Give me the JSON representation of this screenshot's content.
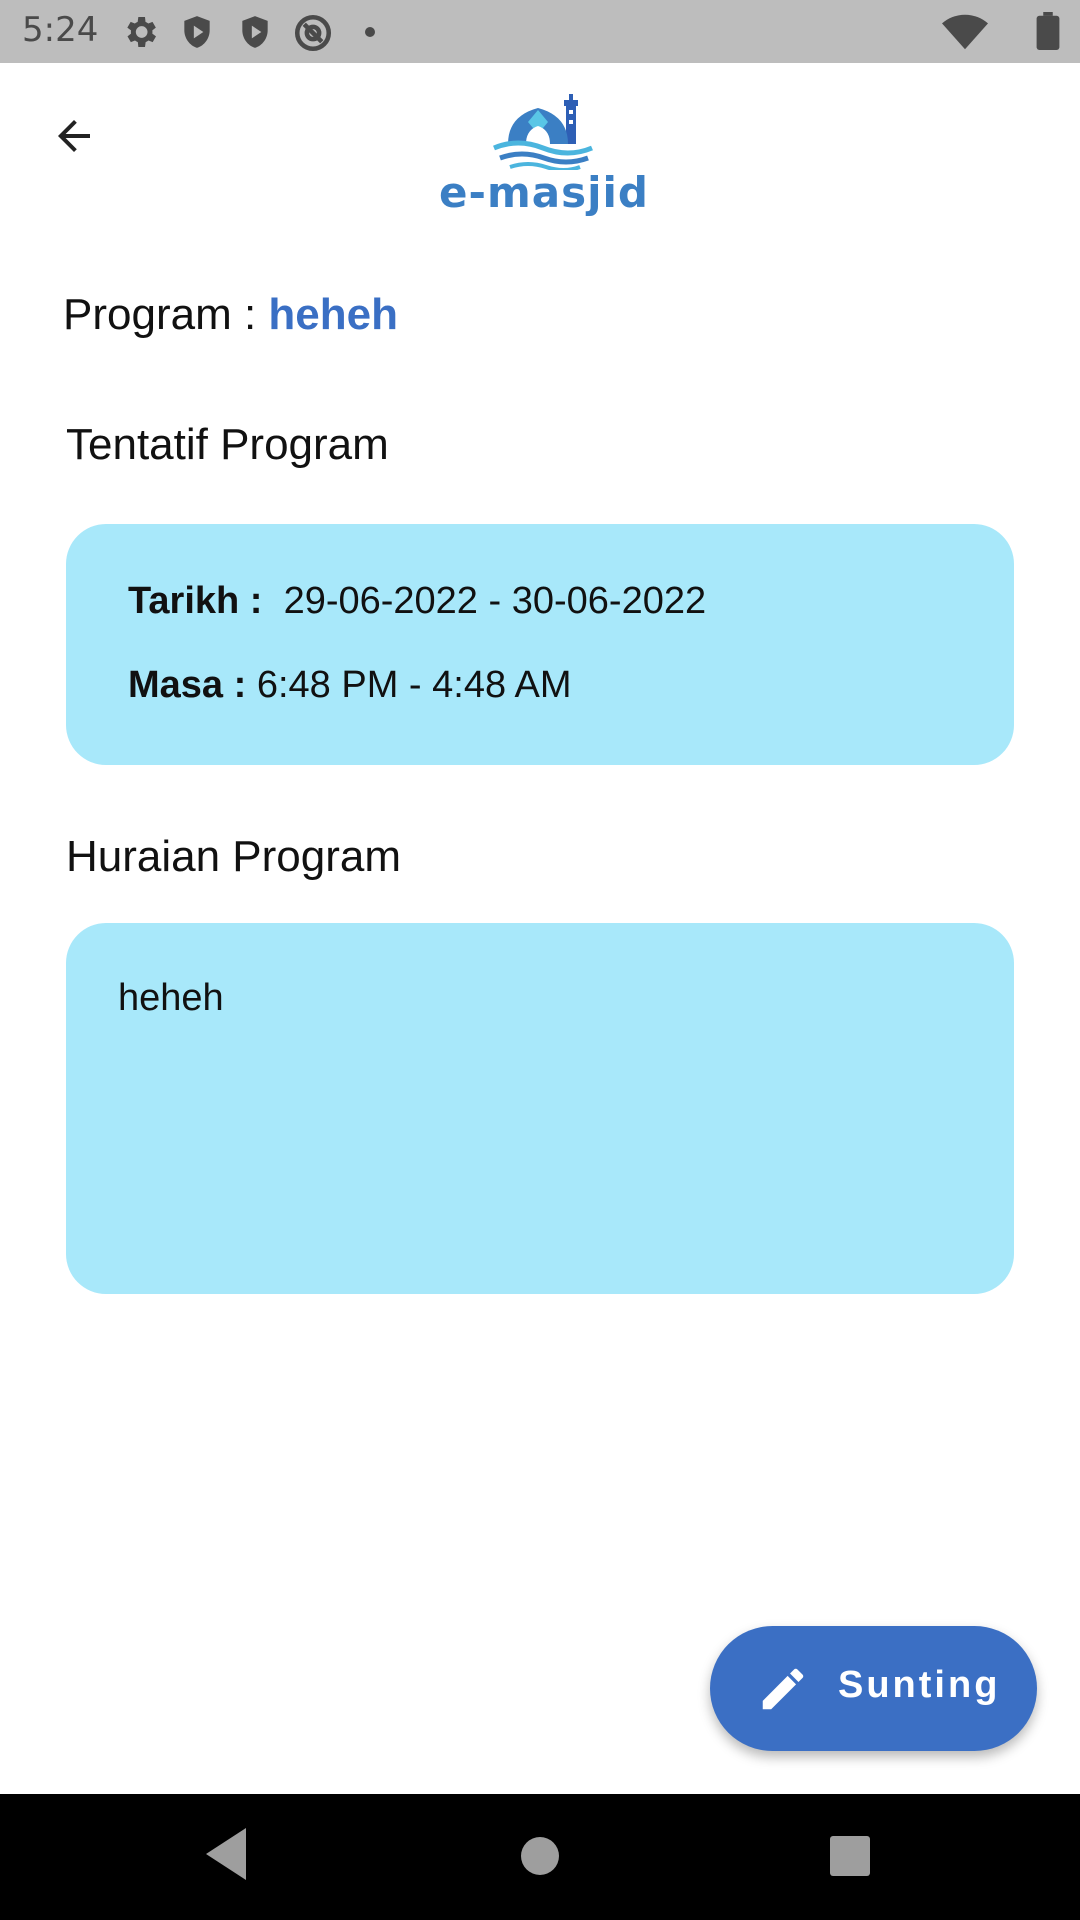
{
  "status_bar": {
    "time": "5:24",
    "icons": [
      "settings-icon",
      "shield-play-icon",
      "shield-play-icon",
      "at-sign-icon",
      "dot-icon",
      "wifi-icon",
      "battery-icon"
    ]
  },
  "app_bar": {
    "back_icon": "arrow-left-icon",
    "logo_text": "e-masjid"
  },
  "program": {
    "label": "Program : ",
    "name": "heheh"
  },
  "tentatif": {
    "title": "Tentatif Program",
    "date_label": "Tarikh : ",
    "date_start": "29-06-2022",
    "date_sep": " - ",
    "date_end": "30-06-2022",
    "time_label": "Masa : ",
    "time_start": "6:48 PM",
    "time_sep": " - ",
    "time_end": "4:48 AM"
  },
  "huraian": {
    "title": "Huraian Program",
    "text": "heheh"
  },
  "fab": {
    "icon": "pencil-icon",
    "label": "Sunting"
  },
  "nav_bar": {
    "icons": [
      "back-triangle-icon",
      "home-circle-icon",
      "recents-square-icon"
    ]
  },
  "colors": {
    "accent": "#3b6fc4",
    "card_bg": "#a8e8fa",
    "status_bar": "#bdbdbd"
  }
}
